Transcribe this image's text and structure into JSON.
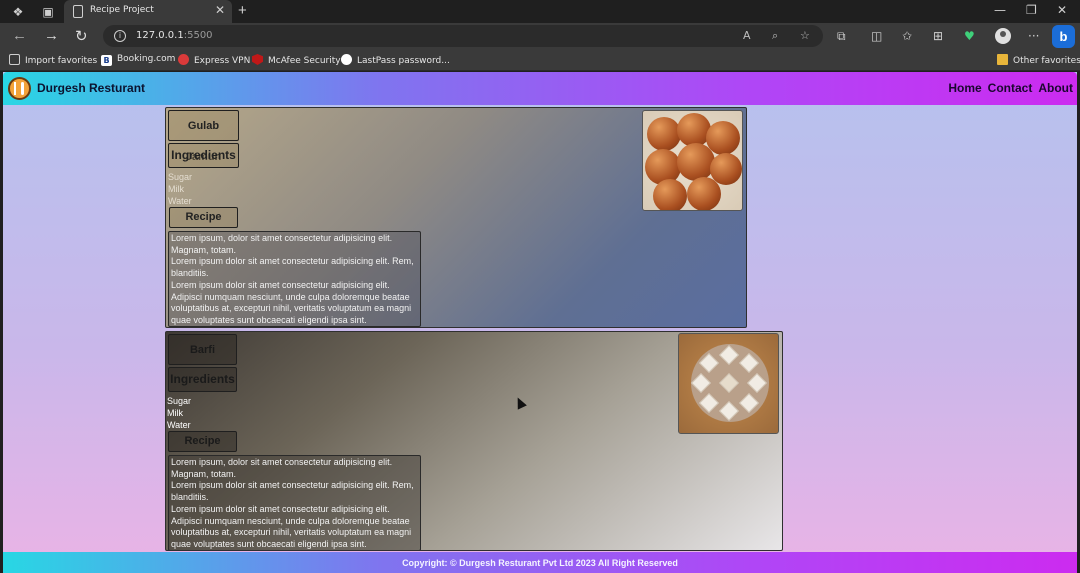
{
  "browser": {
    "tab_title": "Recipe Project",
    "url_host": "127.0.0.1",
    "url_port": ":5500",
    "favorites": [
      {
        "label": "Import favorites",
        "icon": "import-icon"
      },
      {
        "label": "Booking.com",
        "icon": "booking-icon",
        "glyph": "B"
      },
      {
        "label": "Express VPN",
        "icon": "vpn-icon"
      },
      {
        "label": "McAfee Security",
        "icon": "mcafee-icon"
      },
      {
        "label": "LastPass password...",
        "icon": "lastpass-icon"
      }
    ],
    "other_favorites": "Other favorites",
    "profile_letter": "b"
  },
  "site": {
    "brand": "Durgesh Resturant",
    "nav": [
      "Home",
      "Contact",
      "About"
    ],
    "footer": "Copyright: © Durgesh Resturant Pvt Ltd 2023 All Right Reserved"
  },
  "recipes": [
    {
      "name": "Gulab Jamun",
      "ingredients_label": "Ingredients",
      "ingredients": [
        "Sugar",
        "Milk",
        "Water"
      ],
      "recipe_label": "Recipe",
      "recipe_text": "Lorem ipsum, dolor sit amet consectetur adipisicing elit. Magnam, totam.\nLorem ipsum dolor sit amet consectetur adipisicing elit. Rem, blanditiis.\nLorem ipsum dolor sit amet consectetur adipisicing elit. Adipisci numquam nesciunt, unde culpa doloremque beatae voluptatibus at, excepturi nihil, veritatis voluptatum ea magni quae voluptates sunt obcaecati eligendi ipsa sint."
    },
    {
      "name": "Barfi",
      "ingredients_label": "Ingredients",
      "ingredients": [
        "Sugar",
        "Milk",
        "Water"
      ],
      "recipe_label": "Recipe",
      "recipe_text": "Lorem ipsum, dolor sit amet consectetur adipisicing elit. Magnam, totam.\nLorem ipsum dolor sit amet consectetur adipisicing elit. Rem, blanditiis.\nLorem ipsum dolor sit amet consectetur adipisicing elit. Adipisci numquam nesciunt, unde culpa doloremque beatae voluptatibus at, excepturi nihil, veritatis voluptatum ea magni quae voluptates sunt obcaecati eligendi ipsa sint."
    }
  ],
  "colors": {
    "header_gradient_start": "#28d7e4",
    "header_gradient_end": "#cc2bf0",
    "page_bg_top": "#b6c2ee",
    "page_bg_bottom": "#eab3e6"
  }
}
